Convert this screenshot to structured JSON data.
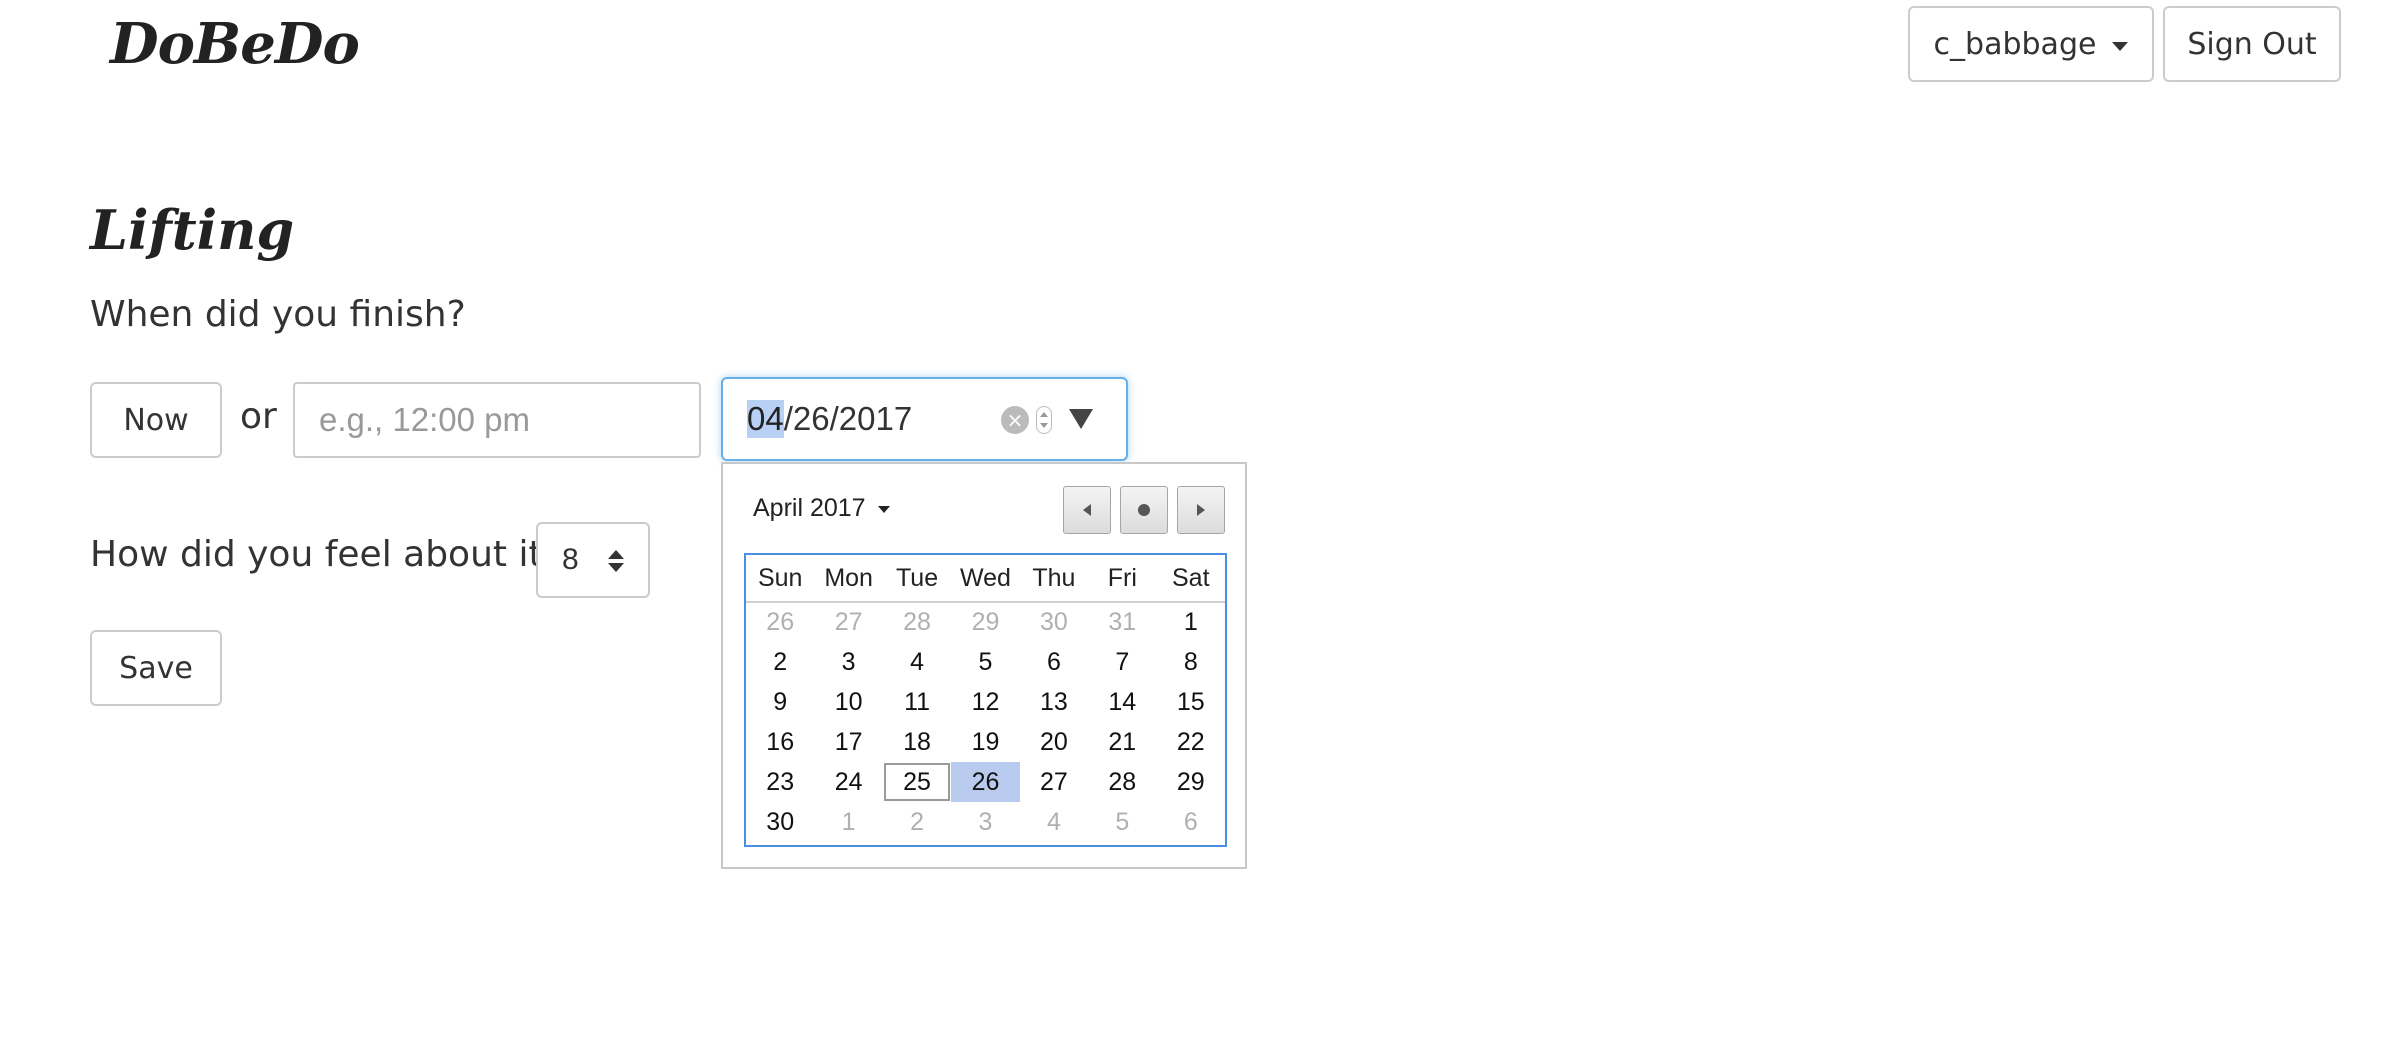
{
  "header": {
    "logo": "DoBeDo",
    "user_menu_label": "c_babbage",
    "sign_out_label": "Sign Out"
  },
  "form": {
    "activity_title": "Lifting",
    "finish_question": "When did you finish?",
    "now_label": "Now",
    "or_label": "or",
    "time_placeholder": "e.g., 12:00 pm",
    "date_value": {
      "month": "04",
      "rest": "/26/2017"
    },
    "feel_question": "How did you feel about it?",
    "rating_value": "8",
    "save_label": "Save"
  },
  "calendar": {
    "month_label": "April 2017",
    "weekdays": [
      "Sun",
      "Mon",
      "Tue",
      "Wed",
      "Thu",
      "Fri",
      "Sat"
    ],
    "weeks": [
      [
        {
          "d": "26",
          "other": true
        },
        {
          "d": "27",
          "other": true
        },
        {
          "d": "28",
          "other": true
        },
        {
          "d": "29",
          "other": true
        },
        {
          "d": "30",
          "other": true
        },
        {
          "d": "31",
          "other": true
        },
        {
          "d": "1"
        }
      ],
      [
        {
          "d": "2"
        },
        {
          "d": "3"
        },
        {
          "d": "4"
        },
        {
          "d": "5"
        },
        {
          "d": "6"
        },
        {
          "d": "7"
        },
        {
          "d": "8"
        }
      ],
      [
        {
          "d": "9"
        },
        {
          "d": "10"
        },
        {
          "d": "11"
        },
        {
          "d": "12"
        },
        {
          "d": "13"
        },
        {
          "d": "14"
        },
        {
          "d": "15"
        }
      ],
      [
        {
          "d": "16"
        },
        {
          "d": "17"
        },
        {
          "d": "18"
        },
        {
          "d": "19"
        },
        {
          "d": "20"
        },
        {
          "d": "21"
        },
        {
          "d": "22"
        }
      ],
      [
        {
          "d": "23"
        },
        {
          "d": "24"
        },
        {
          "d": "25",
          "today": true
        },
        {
          "d": "26",
          "selected": true
        },
        {
          "d": "27"
        },
        {
          "d": "28"
        },
        {
          "d": "29"
        }
      ],
      [
        {
          "d": "30"
        },
        {
          "d": "1",
          "other": true
        },
        {
          "d": "2",
          "other": true
        },
        {
          "d": "3",
          "other": true
        },
        {
          "d": "4",
          "other": true
        },
        {
          "d": "5",
          "other": true
        },
        {
          "d": "6",
          "other": true
        }
      ]
    ],
    "nav_icons": [
      "chevron-left-icon",
      "today-dot-icon",
      "chevron-right-icon"
    ],
    "colors": {
      "selected_bg": "#b8cbee",
      "grid_border": "#4a90e2",
      "other_month_text": "#b0b0b0"
    }
  },
  "colors": {
    "focus_border": "#66afe9",
    "text": "#333333"
  }
}
